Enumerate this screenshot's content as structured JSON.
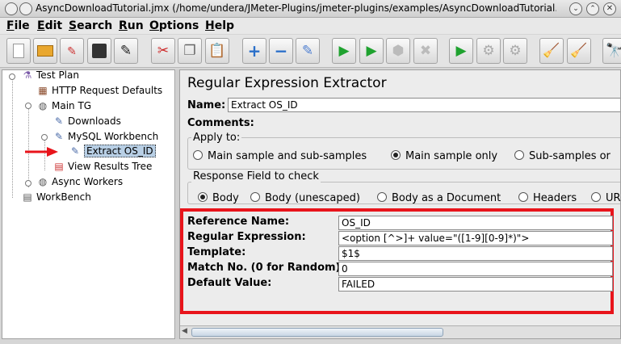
{
  "window": {
    "title": "AsyncDownloadTutorial.jmx (/home/undera/JMeter-Plugins/jmeter-plugins/examples/AsyncDownloadTutorial.j..."
  },
  "menu": [
    "File",
    "Edit",
    "Search",
    "Run",
    "Options",
    "Help"
  ],
  "toolbar_icons": [
    "new-icon",
    "open-icon",
    "save-new-icon",
    "save-icon",
    "edit-icon",
    "cut-icon",
    "copy-icon",
    "paste-icon",
    "expand-icon",
    "collapse-icon",
    "toggle-icon",
    "start-icon",
    "start-no-pause-icon",
    "stop-icon",
    "shutdown-icon",
    "remote-start-icon",
    "remote-stop-icon",
    "remote-shutdown-icon",
    "clear-icon",
    "clear-all-icon",
    "search-icon"
  ],
  "tree": {
    "items": [
      "Test Plan",
      "HTTP Request Defaults",
      "Main TG",
      "Downloads",
      "MySQL Workbench",
      "Extract OS_ID",
      "View Results Tree",
      "Async Workers",
      "WorkBench"
    ]
  },
  "panel": {
    "title": "Regular Expression Extractor",
    "name_label": "Name:",
    "name_value": "Extract OS_ID",
    "comments_label": "Comments:",
    "apply_to": {
      "label": "Apply to:",
      "options": [
        "Main sample and sub-samples",
        "Main sample only",
        "Sub-samples or"
      ],
      "selected": "Main sample only"
    },
    "response_field": {
      "label": "Response Field to check",
      "options": [
        "Body",
        "Body (unescaped)",
        "Body as a Document",
        "Headers",
        "UR"
      ],
      "selected": "Body"
    },
    "fields": [
      {
        "label": "Reference Name:",
        "value": "OS_ID"
      },
      {
        "label": "Regular Expression:",
        "value": "<option [^>]+ value=\"([1-9][0-9]*)\">"
      },
      {
        "label": "Template:",
        "value": "$1$"
      },
      {
        "label": "Match No. (0 for Random):",
        "value": "0"
      },
      {
        "label": "Default Value:",
        "value": "FAILED"
      }
    ]
  },
  "colors": {
    "highlight": "#e8141b",
    "selection": "#b8cfe5"
  }
}
